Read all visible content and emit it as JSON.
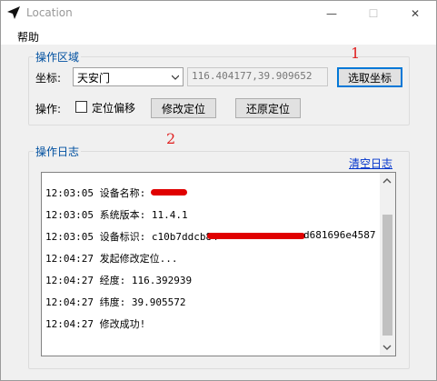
{
  "window": {
    "title": "Location",
    "icon": "navigation-arrow-icon",
    "controls": {
      "minimize": "—",
      "maximize": "☐",
      "close": "✕"
    }
  },
  "menu": {
    "help": "帮助"
  },
  "operation_area": {
    "title": "操作区域",
    "coord_label": "坐标:",
    "location_selected": "天安门",
    "coordinates": "116.404177,39.909652",
    "pick_button": "选取坐标",
    "ops_label": "操作:",
    "offset_checkbox_label": "定位偏移",
    "offset_checked": false,
    "modify_button": "修改定位",
    "restore_button": "还原定位"
  },
  "annotations": {
    "one": "1",
    "two": "2"
  },
  "log": {
    "title": "操作日志",
    "clear_link": "清空日志",
    "lines": [
      "12:03:05 设备名称:",
      "12:03:05 系统版本: 11.4.1",
      "12:03:05 设备标识: c10b7ddcb84",
      "12:04:27 发起修改定位...",
      "12:04:27 经度: 116.392939",
      "12:04:27 纬度: 39.905572",
      "12:04:27 修改成功!"
    ],
    "device_id_tail": "d681696e4587"
  },
  "colors": {
    "accent": "#0078d7",
    "group_title": "#0050a0",
    "annotation": "#e02020",
    "redaction": "#e00000",
    "link": "#0033cc"
  }
}
